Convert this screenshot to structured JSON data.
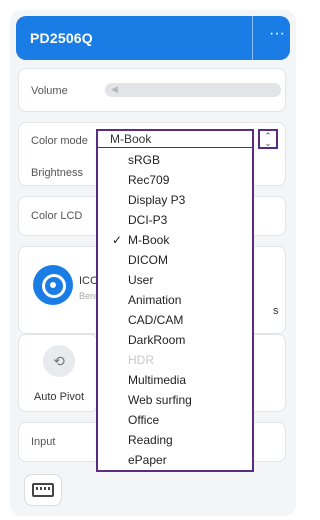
{
  "header": {
    "title": "PD2506Q",
    "more_label": "···"
  },
  "volume": {
    "label": "Volume",
    "icon": "speaker-icon"
  },
  "color_mode": {
    "label": "Color mode",
    "selected": "M-Book",
    "spin_glyph": "⌃⌄",
    "options": [
      {
        "label": "sRGB"
      },
      {
        "label": "Rec709"
      },
      {
        "label": "Display P3"
      },
      {
        "label": "DCI-P3"
      },
      {
        "label": "M-Book",
        "checked": true
      },
      {
        "label": "DICOM"
      },
      {
        "label": "User"
      },
      {
        "label": "Animation"
      },
      {
        "label": "CAD/CAM"
      },
      {
        "label": "DarkRoom"
      },
      {
        "label": "HDR",
        "disabled": true
      },
      {
        "label": "Multimedia"
      },
      {
        "label": "Web surfing"
      },
      {
        "label": "Office"
      },
      {
        "label": "Reading"
      },
      {
        "label": "ePaper"
      }
    ]
  },
  "brightness": {
    "label": "Brightness"
  },
  "color_lcd": {
    "label": "Color LCD"
  },
  "icc": {
    "title": "ICCs",
    "subtitle": "Beni",
    "edge_char": "s"
  },
  "auto_pivot": {
    "label": "Auto Pivot",
    "icon": "rotate-screen-icon"
  },
  "input": {
    "label": "Input"
  },
  "keyboard": {
    "icon": "keyboard-icon"
  },
  "colors": {
    "accent": "#1a7de6",
    "highlight_border": "#5b2a82",
    "disabled_text": "#c9c9c9"
  }
}
